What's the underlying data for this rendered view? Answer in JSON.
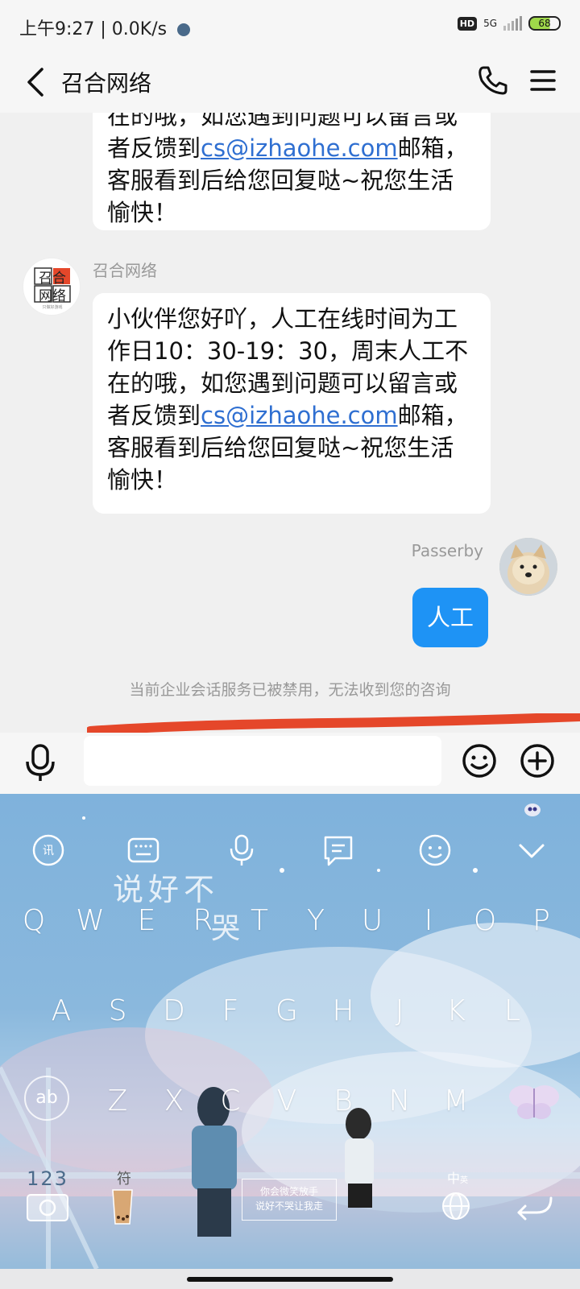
{
  "status_bar": {
    "time_and_speed": "上午9:27 | 0.0K/s",
    "hd": "HD",
    "network": "5G",
    "battery": "68"
  },
  "header": {
    "title": "召合网络"
  },
  "chat": {
    "partial_message": {
      "line1": "在的哦，如您遇到问题可以留言或",
      "line2_pre": "者反馈到",
      "email": "cs@izhaohe.com",
      "line2_post": "邮箱，",
      "line3": "客服看到后给您回复哒~祝您生活",
      "line4": "愉快！"
    },
    "bot": {
      "name": "召合网络",
      "avatar_line1": "召合",
      "avatar_line2": "网络",
      "avatar_tagline": "只做好游戏"
    },
    "bot_message": {
      "line1": "小伙伴您好吖，人工在线时间为工",
      "line2": "作日10：30-19：30，周末人工不",
      "line3": "在的哦，如您遇到问题可以留言或",
      "line4_pre": "者反馈到",
      "email": "cs@izhaohe.com",
      "line4_post": "邮箱，",
      "line5": "客服看到后给您回复哒~祝您生活",
      "line6": "愉快！"
    },
    "user": {
      "name": "Passerby",
      "message": "人工"
    },
    "system_notice": "当前企业会话服务已被禁用，无法收到您的咨询"
  },
  "input": {
    "placeholder": ""
  },
  "keyboard": {
    "decor_text_1": "说好不",
    "decor_text_2": "哭",
    "row1": [
      "Q",
      "W",
      "E",
      "R",
      "T",
      "Y",
      "U",
      "I",
      "O",
      "P"
    ],
    "row2": [
      "A",
      "S",
      "D",
      "F",
      "G",
      "H",
      "J",
      "K",
      "L"
    ],
    "row3": [
      "Z",
      "X",
      "C",
      "V",
      "B",
      "N",
      "M"
    ],
    "shift_label": "ab",
    "numbers_label": "123",
    "symbols_label": "符",
    "space_label_1": "你会微笑放手",
    "space_label_2": "说好不哭让我走",
    "lang_label": "中",
    "lang_sub": "英"
  },
  "colors": {
    "link": "#2f6fd1",
    "user_bubble": "#1e93f5",
    "annotation_red": "#e5472a"
  }
}
